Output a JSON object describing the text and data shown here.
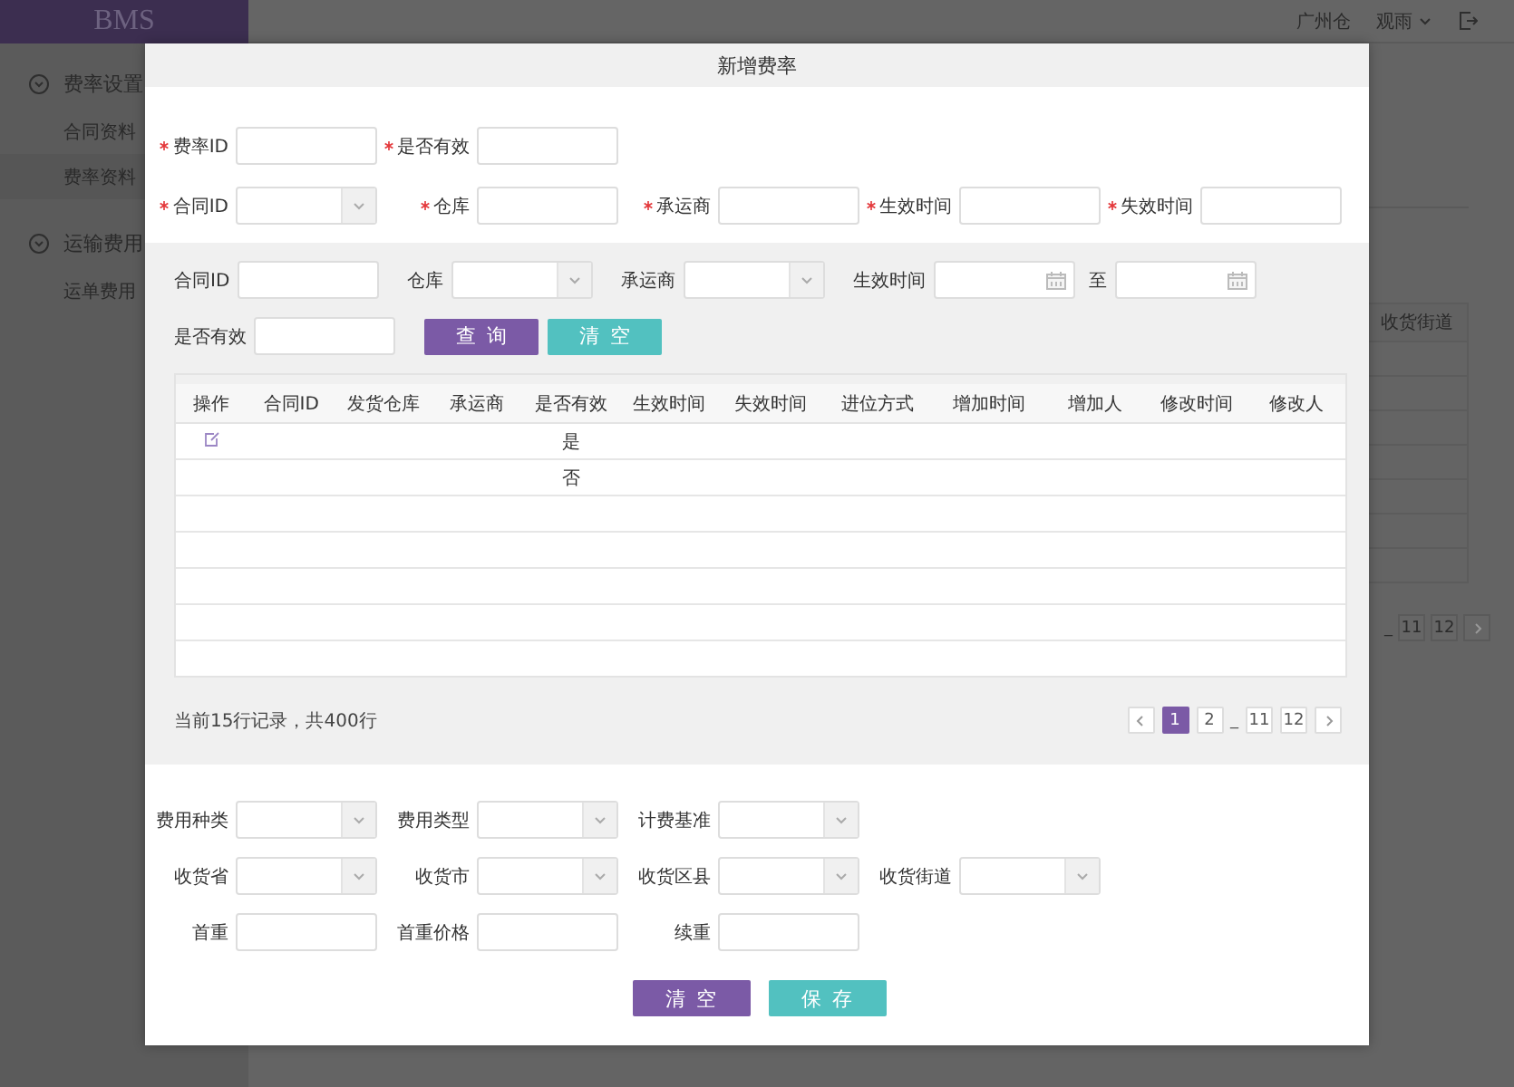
{
  "topbar": {
    "logo": "BMS",
    "warehouse": "广州仓",
    "user": "观雨"
  },
  "sidebar": {
    "groups": [
      {
        "label": "费率设置",
        "expanded": true,
        "items": [
          {
            "label": "合同资料",
            "selected": false
          },
          {
            "label": "费率资料",
            "selected": true
          }
        ]
      },
      {
        "label": "运输费用",
        "expanded": true,
        "items": [
          {
            "label": "运单费用",
            "selected": false
          }
        ]
      }
    ]
  },
  "background_table": {
    "columns": [
      "收货街道"
    ],
    "pager": [
      {
        "kind": "gap",
        "label": "_"
      },
      {
        "kind": "page",
        "label": "11",
        "selected": false
      },
      {
        "kind": "page",
        "label": "12",
        "selected": false
      },
      {
        "kind": "next"
      }
    ]
  },
  "dialog": {
    "title": "新增费率",
    "rate_form": {
      "rows": [
        [
          {
            "label": "费率ID",
            "kind": "text",
            "required": true
          },
          {
            "label": "是否有效",
            "kind": "text",
            "required": true
          }
        ],
        [
          {
            "label": "合同ID",
            "kind": "select",
            "required": true
          },
          {
            "label": "仓库",
            "kind": "text",
            "required": true
          },
          {
            "label": "承运商",
            "kind": "text",
            "required": true
          },
          {
            "label": "生效时间",
            "kind": "text",
            "required": true
          },
          {
            "label": "失效时间",
            "kind": "text",
            "required": true
          }
        ]
      ]
    },
    "search": {
      "rows": [
        {
          "fields": [
            {
              "label": "合同ID",
              "kind": "text"
            },
            {
              "label": "仓库",
              "kind": "select"
            },
            {
              "label": "承运商",
              "kind": "select"
            },
            {
              "label": "生效时间",
              "kind": "date"
            },
            {
              "label": "至",
              "kind": "date"
            }
          ]
        },
        {
          "fields": [
            {
              "label": "是否有效",
              "kind": "text"
            }
          ],
          "buttons": [
            {
              "label": "查询",
              "kind": "primary"
            },
            {
              "label": "清空",
              "kind": "secondary"
            }
          ]
        }
      ]
    },
    "table": {
      "columns": [
        "操作",
        "合同ID",
        "发货仓库",
        "承运商",
        "是否有效",
        "生效时间",
        "失效时间",
        "进位方式",
        "增加时间",
        "增加人",
        "修改时间",
        "修改人"
      ],
      "rows": [
        {
          "kind": "data",
          "edit_icon": true,
          "is_valid": "是"
        },
        {
          "kind": "data",
          "edit_icon": false,
          "is_valid": "否"
        },
        {
          "kind": "blank"
        },
        {
          "kind": "blank"
        },
        {
          "kind": "blank"
        },
        {
          "kind": "blank"
        },
        {
          "kind": "blank"
        }
      ]
    },
    "pager": {
      "info": "当前15行记录，共400行",
      "items": [
        {
          "kind": "prev"
        },
        {
          "kind": "page",
          "label": "1",
          "selected": true
        },
        {
          "kind": "page",
          "label": "2",
          "selected": false
        },
        {
          "kind": "gap",
          "label": "_"
        },
        {
          "kind": "page",
          "label": "11",
          "selected": false
        },
        {
          "kind": "page",
          "label": "12",
          "selected": false
        },
        {
          "kind": "next"
        }
      ]
    },
    "fee_form": {
      "rows": [
        [
          {
            "label": "费用种类",
            "kind": "select"
          },
          {
            "label": "费用类型",
            "kind": "select"
          },
          {
            "label": "计费基准",
            "kind": "select"
          }
        ],
        [
          {
            "label": "收货省",
            "kind": "select"
          },
          {
            "label": "收货市",
            "kind": "select"
          },
          {
            "label": "收货区县",
            "kind": "select"
          },
          {
            "label": "收货街道",
            "kind": "select"
          }
        ],
        [
          {
            "label": "首重",
            "kind": "text"
          },
          {
            "label": "首重价格",
            "kind": "text"
          },
          {
            "label": "续重",
            "kind": "text"
          }
        ]
      ]
    },
    "buttons": [
      {
        "label": "清空",
        "kind": "primary"
      },
      {
        "label": "保存",
        "kind": "secondary"
      }
    ]
  }
}
